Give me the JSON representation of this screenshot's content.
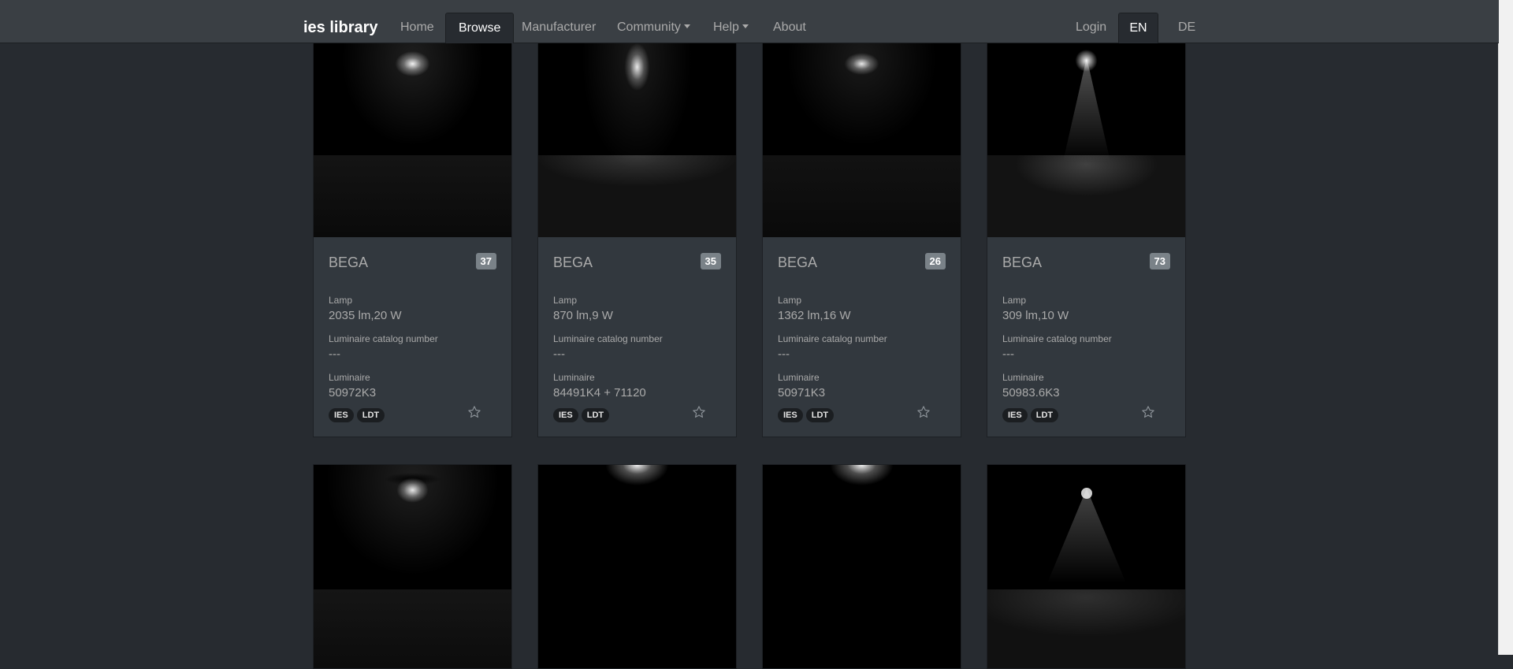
{
  "nav": {
    "brand": "ies library",
    "items": [
      {
        "label": "Home"
      },
      {
        "label": "Browse"
      },
      {
        "label": "Manufacturer"
      },
      {
        "label": "Community"
      },
      {
        "label": "Help"
      },
      {
        "label": "About"
      }
    ],
    "login": "Login",
    "lang_en": "EN",
    "lang_de": "DE"
  },
  "cards": [
    {
      "manufacturer": "BEGA",
      "count": "37",
      "lamp_label": "Lamp",
      "lamp": "2035 lm,20 W",
      "catalog_label": "Luminaire catalog number",
      "catalog": "---",
      "luminaire_label": "Luminaire",
      "luminaire": "50972K3",
      "tags": [
        "IES",
        "LDT"
      ]
    },
    {
      "manufacturer": "BEGA",
      "count": "35",
      "lamp_label": "Lamp",
      "lamp": "870 lm,9 W",
      "catalog_label": "Luminaire catalog number",
      "catalog": "---",
      "luminaire_label": "Luminaire",
      "luminaire": "84491K4 + 71120",
      "tags": [
        "IES",
        "LDT"
      ]
    },
    {
      "manufacturer": "BEGA",
      "count": "26",
      "lamp_label": "Lamp",
      "lamp": "1362 lm,16 W",
      "catalog_label": "Luminaire catalog number",
      "catalog": "---",
      "luminaire_label": "Luminaire",
      "luminaire": "50971K3",
      "tags": [
        "IES",
        "LDT"
      ]
    },
    {
      "manufacturer": "BEGA",
      "count": "73",
      "lamp_label": "Lamp",
      "lamp": "309 lm,10 W",
      "catalog_label": "Luminaire catalog number",
      "catalog": "---",
      "luminaire_label": "Luminaire",
      "luminaire": "50983.6K3",
      "tags": [
        "IES",
        "LDT"
      ]
    }
  ],
  "colors": {
    "background": "#272b30",
    "navbar": "#3a3f44",
    "card": "#32383e",
    "badge": "#7a8288"
  }
}
